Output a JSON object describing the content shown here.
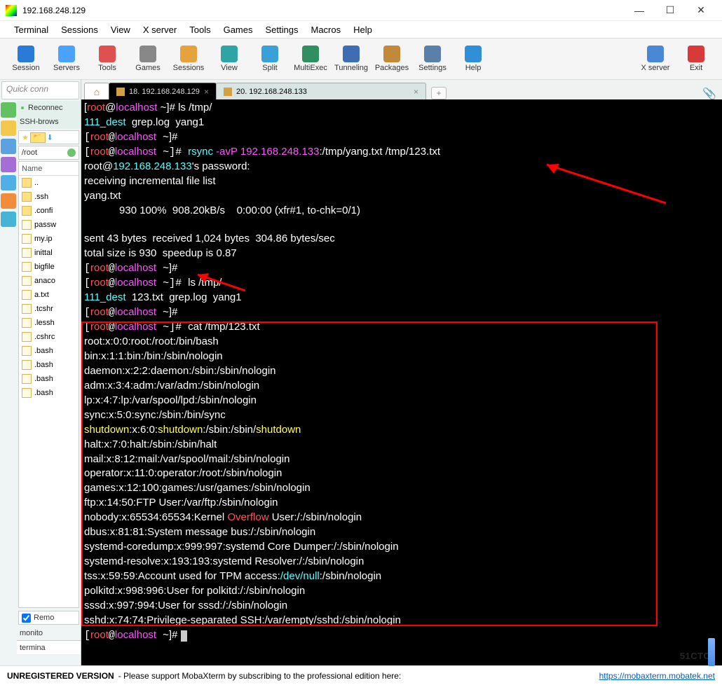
{
  "window": {
    "title": "192.168.248.129"
  },
  "wbtn": {
    "min": "—",
    "max": "☐",
    "close": "✕"
  },
  "menu": [
    "Terminal",
    "Sessions",
    "View",
    "X server",
    "Tools",
    "Games",
    "Settings",
    "Macros",
    "Help"
  ],
  "toolbar": [
    {
      "label": "Session",
      "color": "#2a7bd8"
    },
    {
      "label": "Servers",
      "color": "#4ca3ff"
    },
    {
      "label": "Tools",
      "color": "#e05050"
    },
    {
      "label": "Games",
      "color": "#888"
    },
    {
      "label": "Sessions",
      "color": "#e6a23c"
    },
    {
      "label": "View",
      "color": "#2fa4a4"
    },
    {
      "label": "Split",
      "color": "#3aa0d8"
    },
    {
      "label": "MultiExec",
      "color": "#2f8f5f"
    },
    {
      "label": "Tunneling",
      "color": "#3e6db4"
    },
    {
      "label": "Packages",
      "color": "#c08a3a"
    },
    {
      "label": "Settings",
      "color": "#5a7fa8"
    },
    {
      "label": "Help",
      "color": "#2f8fd8"
    }
  ],
  "toolbar_right": [
    {
      "label": "X server",
      "color": "#4a88d6"
    },
    {
      "label": "Exit",
      "color": "#d83a3a"
    }
  ],
  "sidebar": {
    "quickconn": "Quick conn",
    "reconnect": "Reconnec",
    "sshbrowse": "SSH-brows",
    "path": "/root",
    "namehdr": "Name",
    "files": [
      {
        "name": "..",
        "dir": true
      },
      {
        "name": ".ssh",
        "dir": true
      },
      {
        "name": ".confi",
        "dir": true
      },
      {
        "name": "passw",
        "dir": false
      },
      {
        "name": "my.ip",
        "dir": false
      },
      {
        "name": "inittal",
        "dir": false
      },
      {
        "name": "bigfile",
        "dir": false
      },
      {
        "name": "anaco",
        "dir": false
      },
      {
        "name": "a.txt",
        "dir": false
      },
      {
        "name": ".tcshr",
        "dir": false
      },
      {
        "name": ".lessh",
        "dir": false
      },
      {
        "name": ".cshrc",
        "dir": false
      },
      {
        "name": ".bash",
        "dir": false
      },
      {
        "name": ".bash",
        "dir": false
      },
      {
        "name": ".bash",
        "dir": false
      },
      {
        "name": ".bash",
        "dir": false
      }
    ],
    "remote": "Remo",
    "monitor": "monito",
    "termin": "termina"
  },
  "stripcolors": [
    "#62c262",
    "#f2c94c",
    "#5aa2e0",
    "#a46ed6",
    "#4fb0e8",
    "#f28c3a",
    "#46b4d6"
  ],
  "tabs": {
    "home": "⌂",
    "active": "18. 192.168.248.129",
    "other": "20. 192.168.248.133"
  },
  "term": {
    "l1a": "[",
    "l1b": "root",
    "l1c": "@",
    "l1d": "localhost",
    "l1e": " ~]# ",
    "l1f": "ls /tmp/",
    "l2a": "111_dest",
    "l2b": "  grep.log  yang1",
    "l3": "~]#",
    "l4cmd": "rsync",
    "l4opt": " -avP ",
    "l4ip": "192.168.248.133",
    "l4rest": ":/tmp/yang.txt /tmp/123.txt",
    "l5a": "root@",
    "l5b": "192.168.248.133",
    "l5c": "'s password:",
    "l6": "receiving incremental file list",
    "l7": "yang.txt",
    "l8": "            930 100%  908.20kB/s    0:00:00 (xfr#1, to-chk=0/1)",
    "l9": "sent 43 bytes  received 1,024 bytes  304.86 bytes/sec",
    "l10": "total size is 930  speedup is 0.87",
    "l11": "~]#",
    "l12": "ls /tmp/",
    "l13a": "111_dest",
    "l13b": "  123.txt  grep.log  yang1",
    "l14": "~]#",
    "l15": "cat /tmp/123.txt",
    "p1": "root:x:0:0:root:/root:/bin/bash",
    "p2": "bin:x:1:1:bin:/bin:/sbin/nologin",
    "p3": "daemon:x:2:2:daemon:/sbin:/sbin/nologin",
    "p4": "adm:x:3:4:adm:/var/adm:/sbin/nologin",
    "p5": "lp:x:4:7:lp:/var/spool/lpd:/sbin/nologin",
    "p6": "sync:x:5:0:sync:/sbin:/bin/sync",
    "p7a": "shutdown",
    "p7b": ":x:6:0:",
    "p7c": "shutdown",
    "p7d": ":/sbin:/sbin/",
    "p7e": "shutdown",
    "p8": "halt:x:7:0:halt:/sbin:/sbin/halt",
    "p9": "mail:x:8:12:mail:/var/spool/mail:/sbin/nologin",
    "p10": "operator:x:11:0:operator:/root:/sbin/nologin",
    "p11": "games:x:12:100:games:/usr/games:/sbin/nologin",
    "p12": "ftp:x:14:50:FTP User:/var/ftp:/sbin/nologin",
    "p13a": "nobody:x:65534:65534:Kernel ",
    "p13b": "Overflow",
    "p13c": " User:/:/sbin/nologin",
    "p14": "dbus:x:81:81:System message bus:/:/sbin/nologin",
    "p15": "systemd-coredump:x:999:997:systemd Core Dumper:/:/sbin/nologin",
    "p16": "systemd-resolve:x:193:193:systemd Resolver:/:/sbin/nologin",
    "p17a": "tss:x:59:59:Account used for TPM access:",
    "p17b": "/dev/null",
    "p17c": ":/sbin/nologin",
    "p18": "polkitd:x:998:996:User for polkitd:/:/sbin/nologin",
    "p19": "sssd:x:997:994:User for sssd:/:/sbin/nologin",
    "p20": "sshd:x:74:74:Privilege-separated SSH:/var/empty/sshd:/sbin/nologin",
    "lend": "~]# "
  },
  "footer": {
    "unreg": "UNREGISTERED VERSION",
    "msg": " -  Please support MobaXterm by subscribing to the professional edition here:",
    "link": "https://mobaxterm.mobatek.net"
  },
  "watermark": "51CTO"
}
